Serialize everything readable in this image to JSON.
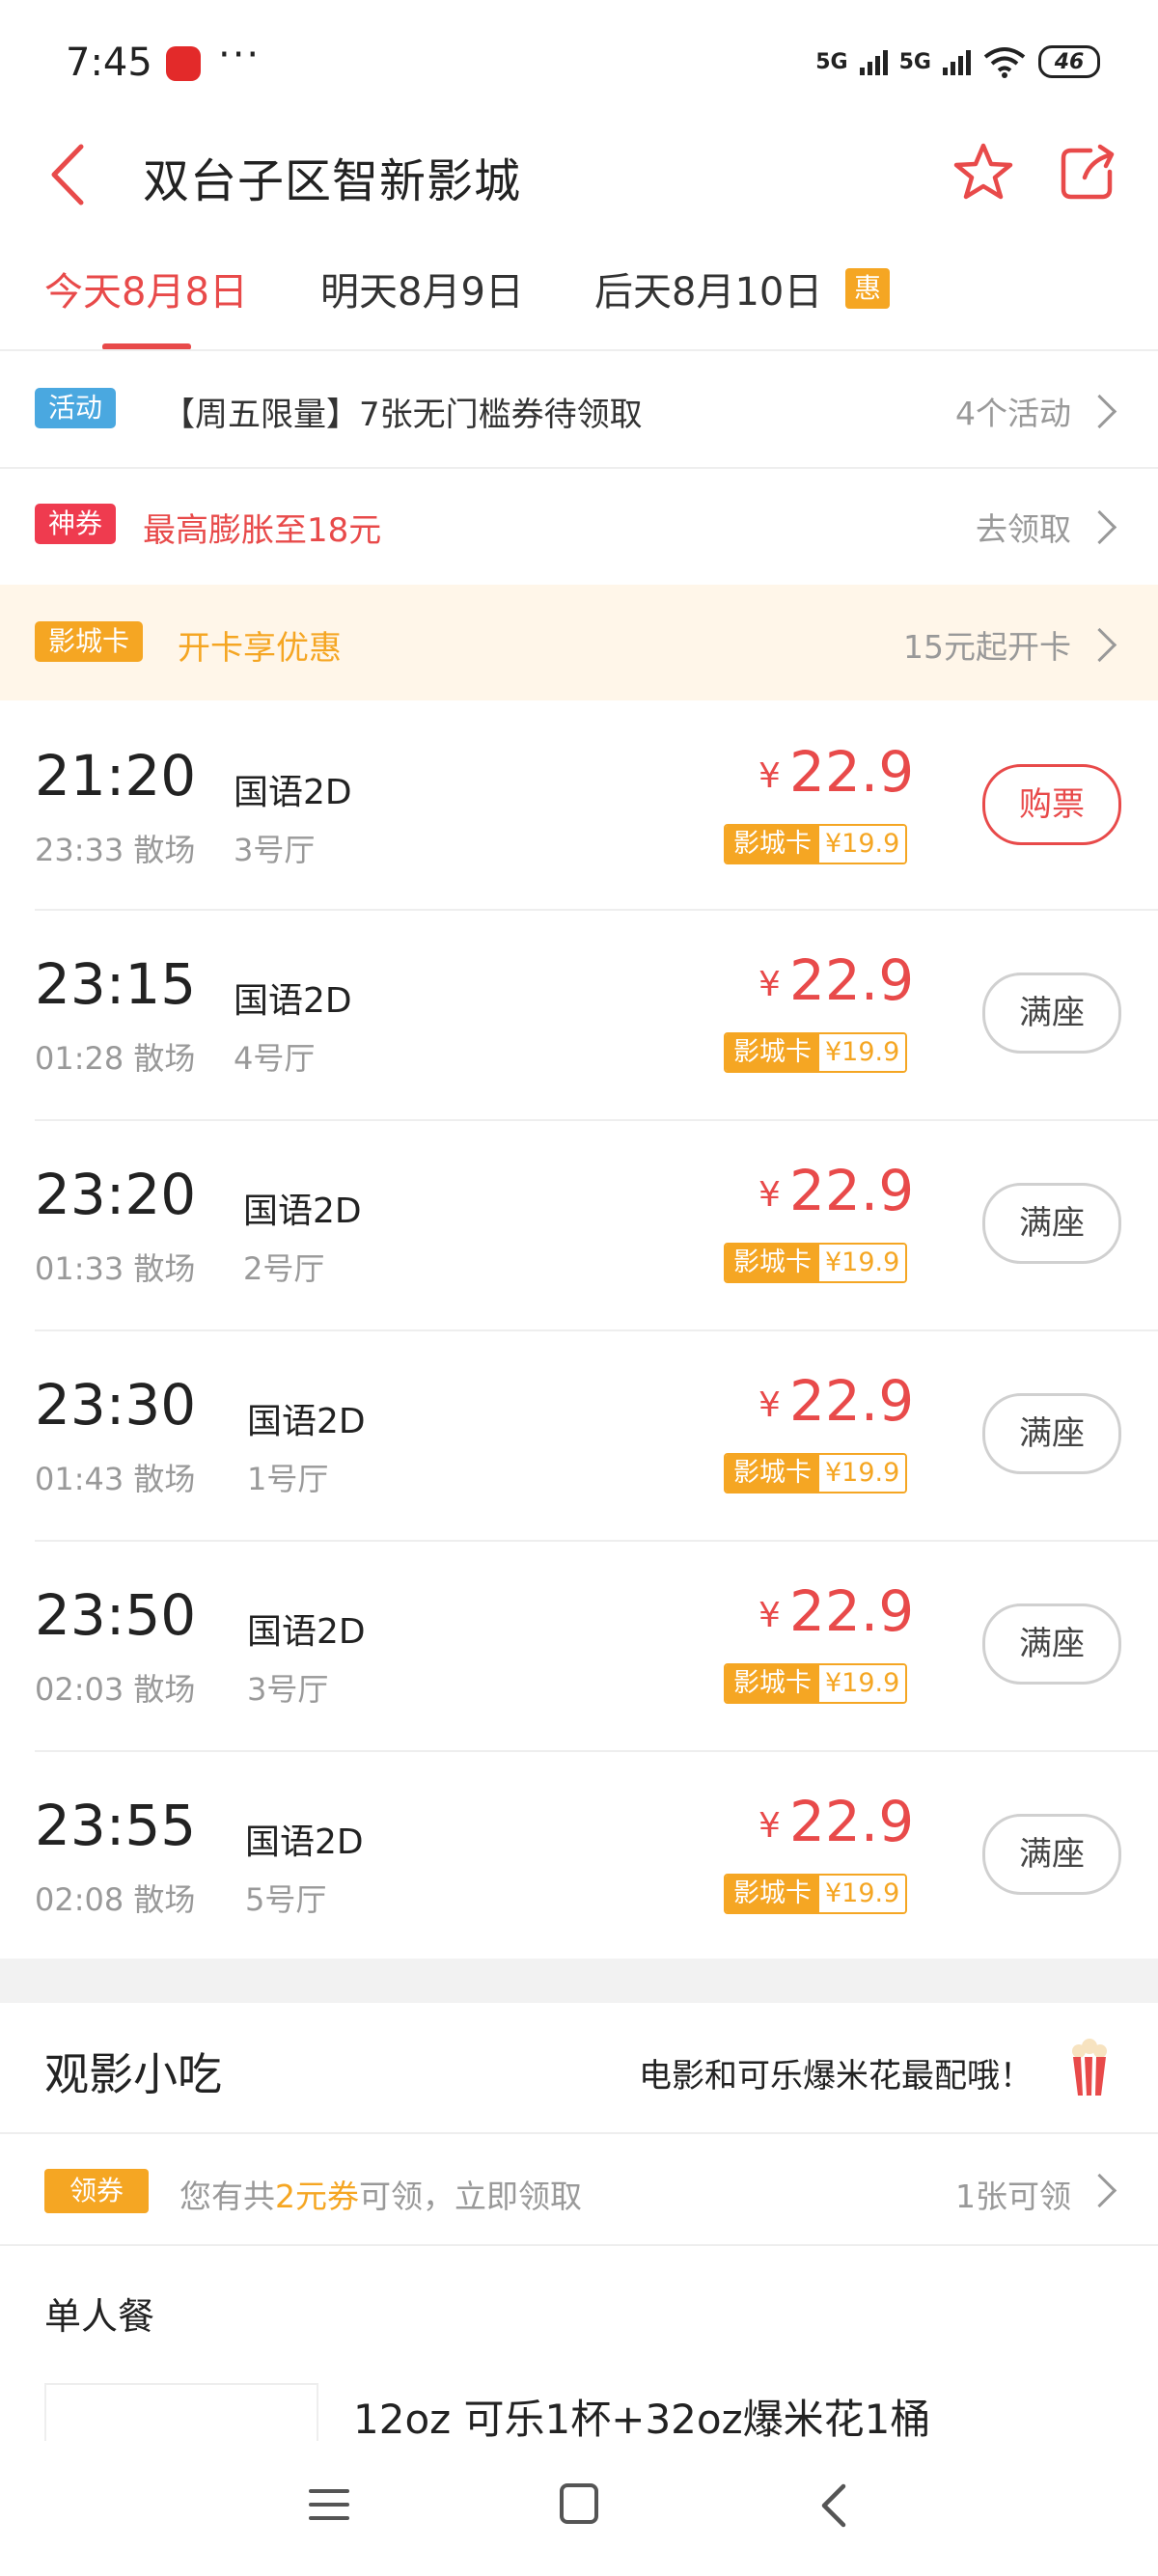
{
  "status_bar": {
    "time": "7:45",
    "dots": "···",
    "network_1": "5G",
    "network_2": "5G",
    "battery": "46"
  },
  "header": {
    "title": "双台子区智新影城"
  },
  "date_tabs": [
    {
      "label": "今天8月8日",
      "active": true
    },
    {
      "label": "明天8月9日",
      "active": false
    },
    {
      "label": "后天8月10日",
      "active": false,
      "badge": "惠"
    }
  ],
  "promos": {
    "activity": {
      "badge": "活动",
      "text": "【周五限量】7张无门槛券待领取",
      "right": "4个活动"
    },
    "coupon": {
      "badge": "神券",
      "text": "最高膨胀至18元",
      "right": "去领取"
    },
    "card": {
      "badge": "影城卡",
      "text": "开卡享优惠",
      "right": "15元起开卡"
    }
  },
  "showtimes": [
    {
      "start": "21:20",
      "end": "23:33 散场",
      "lang": "国语2D",
      "hall": "3号厅",
      "yen": "¥",
      "price": "22.9",
      "card_label": "影城卡",
      "card_price": "¥19.9",
      "button": "购票"
    },
    {
      "start": "23:15",
      "end": "01:28 散场",
      "lang": "国语2D",
      "hall": "4号厅",
      "yen": "¥",
      "price": "22.9",
      "card_label": "影城卡",
      "card_price": "¥19.9",
      "button": "满座"
    },
    {
      "start": "23:20",
      "end": "01:33 散场",
      "lang": "国语2D",
      "hall": "2号厅",
      "yen": "¥",
      "price": "22.9",
      "card_label": "影城卡",
      "card_price": "¥19.9",
      "button": "满座"
    },
    {
      "start": "23:30",
      "end": "01:43 散场",
      "lang": "国语2D",
      "hall": "1号厅",
      "yen": "¥",
      "price": "22.9",
      "card_label": "影城卡",
      "card_price": "¥19.9",
      "button": "满座"
    },
    {
      "start": "23:50",
      "end": "02:03 散场",
      "lang": "国语2D",
      "hall": "3号厅",
      "yen": "¥",
      "price": "22.9",
      "card_label": "影城卡",
      "card_price": "¥19.9",
      "button": "满座"
    },
    {
      "start": "23:55",
      "end": "02:08 散场",
      "lang": "国语2D",
      "hall": "5号厅",
      "yen": "¥",
      "price": "22.9",
      "card_label": "影城卡",
      "card_price": "¥19.9",
      "button": "满座"
    }
  ],
  "snacks": {
    "title": "观影小吃",
    "slogan": "电影和可乐爆米花最配哦！",
    "coupon_badge": "领券",
    "coupon_prefix": "您有共",
    "coupon_highlight": "2元券",
    "coupon_suffix": "可领，立即领取",
    "coupon_right": "1张可领",
    "section": "单人餐",
    "meal_name": "12oz 可乐1杯+32oz爆米花1桶"
  },
  "colors": {
    "accent_red": "#e84a4a",
    "accent_orange": "#f5a623",
    "activity_blue": "#4aa8e0",
    "coupon_red": "#ef3b4f"
  }
}
